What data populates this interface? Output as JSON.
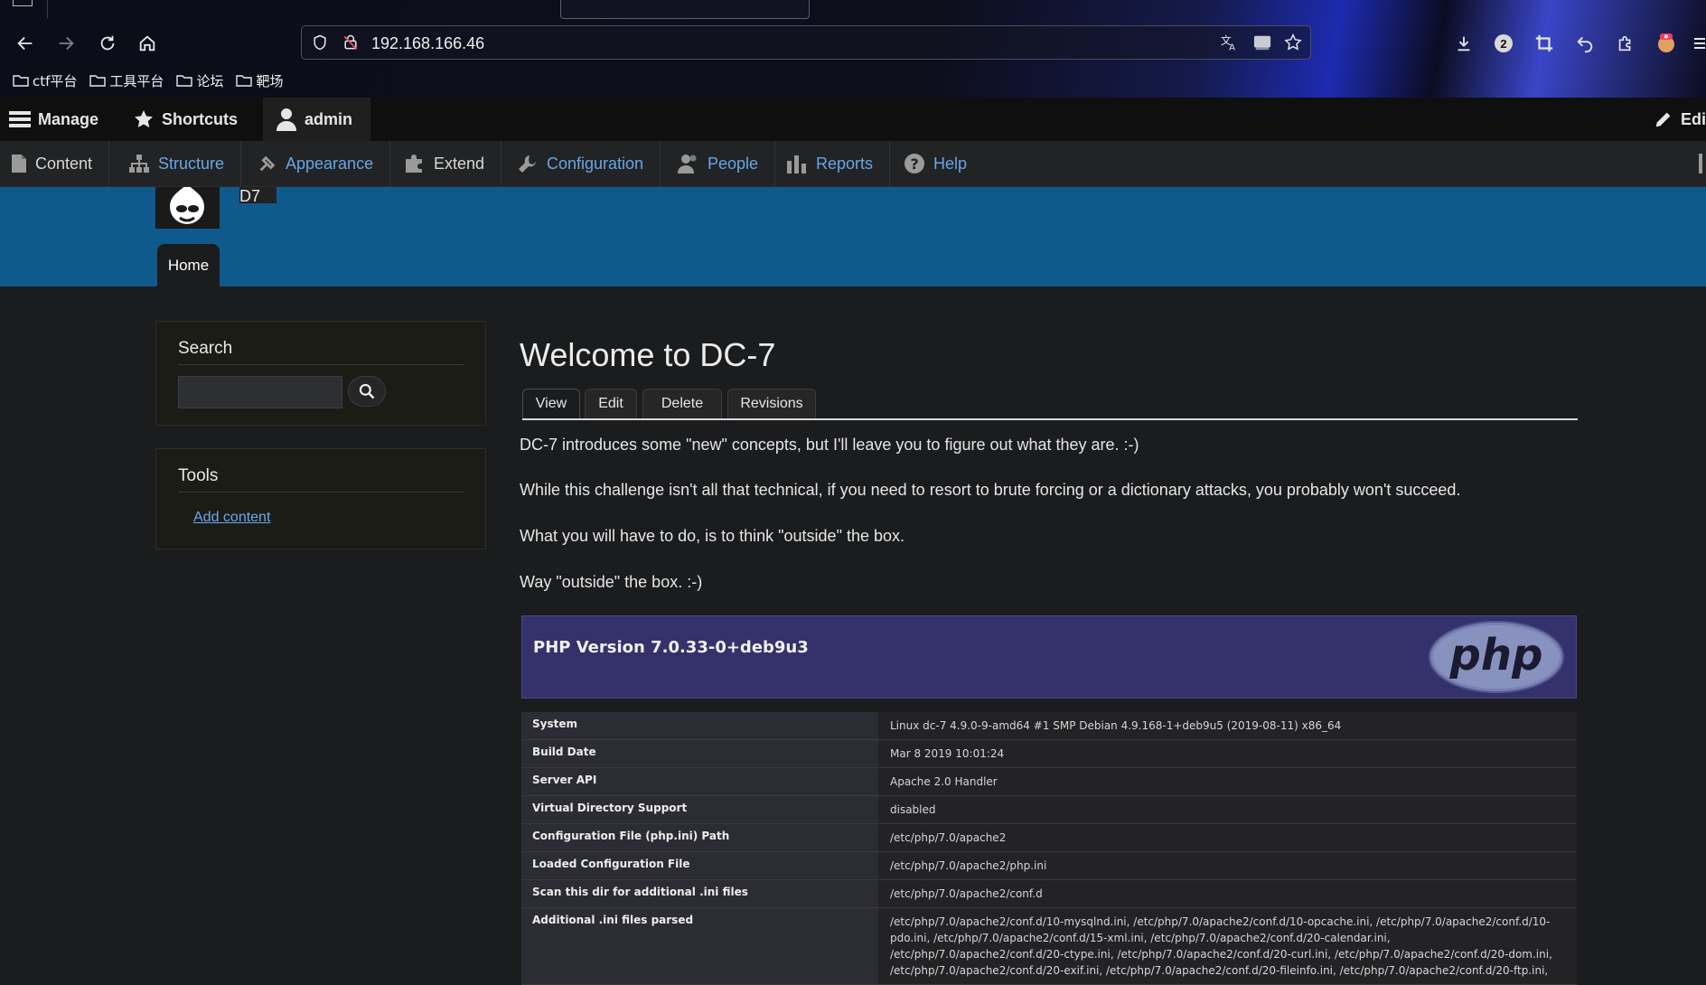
{
  "browser": {
    "url": "192.168.166.46",
    "bookmarks": [
      {
        "label": "ctf平台"
      },
      {
        "label": "工具平台"
      },
      {
        "label": "论坛"
      },
      {
        "label": "靶场"
      }
    ],
    "badge_count": "2"
  },
  "toolbar": {
    "manage_label": "Manage",
    "shortcuts_label": "Shortcuts",
    "user_label": "admin",
    "edit_label": "Edi"
  },
  "tray": {
    "items": [
      {
        "label": "Content",
        "icon": "file-icon"
      },
      {
        "label": "Structure",
        "icon": "sitemap-icon"
      },
      {
        "label": "Appearance",
        "icon": "brush-icon"
      },
      {
        "label": "Extend",
        "icon": "puzzle-icon"
      },
      {
        "label": "Configuration",
        "icon": "wrench-icon"
      },
      {
        "label": "People",
        "icon": "people-icon"
      },
      {
        "label": "Reports",
        "icon": "bar-chart-icon"
      },
      {
        "label": "Help",
        "icon": "help-icon"
      }
    ]
  },
  "site": {
    "name_fragment": "D7",
    "home_tab": "Home"
  },
  "sidebar": {
    "search_title": "Search",
    "tools_title": "Tools",
    "add_content": "Add content"
  },
  "main": {
    "title": "Welcome to DC-7",
    "tabs": [
      "View",
      "Edit",
      "Delete",
      "Revisions"
    ],
    "paragraphs": [
      "DC-7 introduces some \"new\" concepts, but I'll leave you to figure out what they are.  :-)",
      "While this challenge isn't all that technical, if you need to resort to brute forcing or a dictionary attacks, you probably won't succeed.",
      "What you will have to do, is to think \"outside\" the box.",
      "Way \"outside\" the box.  :-)"
    ]
  },
  "phpinfo": {
    "version": "PHP Version 7.0.33-0+deb9u3",
    "logo_text": "php",
    "rows": [
      {
        "key": "System",
        "value": "Linux dc-7 4.9.0-9-amd64 #1 SMP Debian 4.9.168-1+deb9u5 (2019-08-11) x86_64"
      },
      {
        "key": "Build Date",
        "value": "Mar 8 2019 10:01:24"
      },
      {
        "key": "Server API",
        "value": "Apache 2.0 Handler"
      },
      {
        "key": "Virtual Directory Support",
        "value": "disabled"
      },
      {
        "key": "Configuration File (php.ini) Path",
        "value": "/etc/php/7.0/apache2"
      },
      {
        "key": "Loaded Configuration File",
        "value": "/etc/php/7.0/apache2/php.ini"
      },
      {
        "key": "Scan this dir for additional .ini files",
        "value": "/etc/php/7.0/apache2/conf.d"
      },
      {
        "key": "Additional .ini files parsed",
        "value": "/etc/php/7.0/apache2/conf.d/10-mysqlnd.ini, /etc/php/7.0/apache2/conf.d/10-opcache.ini, /etc/php/7.0/apache2/conf.d/10-pdo.ini, /etc/php/7.0/apache2/conf.d/15-xml.ini, /etc/php/7.0/apache2/conf.d/20-calendar.ini, /etc/php/7.0/apache2/conf.d/20-ctype.ini, /etc/php/7.0/apache2/conf.d/20-curl.ini, /etc/php/7.0/apache2/conf.d/20-dom.ini, /etc/php/7.0/apache2/conf.d/20-exif.ini, /etc/php/7.0/apache2/conf.d/20-fileinfo.ini, /etc/php/7.0/apache2/conf.d/20-ftp.ini,"
      }
    ]
  },
  "colors": {
    "header_blue": "#0f5a8c",
    "link_blue": "#67a6e8",
    "php_header": "#35316b"
  }
}
